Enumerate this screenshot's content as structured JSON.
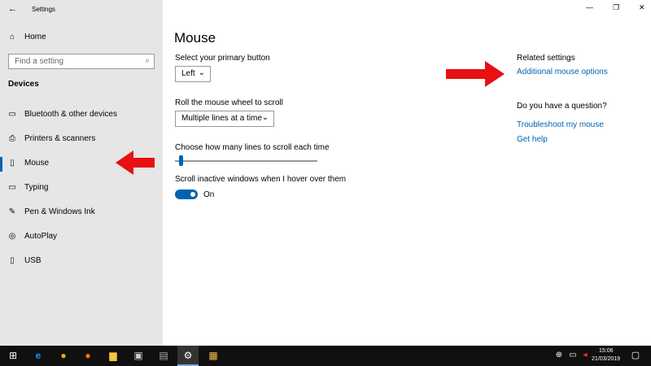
{
  "window": {
    "title": "Settings",
    "minimize": "—",
    "maximize": "❐",
    "close": "✕"
  },
  "sidebar": {
    "home": "Home",
    "search_placeholder": "Find a setting",
    "section": "Devices",
    "items": [
      {
        "label": "Bluetooth & other devices",
        "icon": "bluetooth-icon"
      },
      {
        "label": "Printers & scanners",
        "icon": "printer-icon"
      },
      {
        "label": "Mouse",
        "icon": "mouse-icon"
      },
      {
        "label": "Typing",
        "icon": "keyboard-icon"
      },
      {
        "label": "Pen & Windows Ink",
        "icon": "pen-icon"
      },
      {
        "label": "AutoPlay",
        "icon": "autoplay-icon"
      },
      {
        "label": "USB",
        "icon": "usb-icon"
      }
    ]
  },
  "main": {
    "title": "Mouse",
    "primary_label": "Select your primary button",
    "primary_value": "Left",
    "wheel_label": "Roll the mouse wheel to scroll",
    "wheel_value": "Multiple lines at a time",
    "lines_label": "Choose how many lines to scroll each time",
    "lines_value_fraction": 0.03,
    "inactive_label": "Scroll inactive windows when I hover over them",
    "inactive_state": "On"
  },
  "related": {
    "heading": "Related settings",
    "additional": "Additional mouse options",
    "question": "Do you have a question?",
    "troubleshoot": "Troubleshoot my mouse",
    "help": "Get help"
  },
  "taskbar": {
    "time": "15:06",
    "date": "21/03/2019"
  },
  "colors": {
    "accent": "#0063b1",
    "arrow": "#e81010"
  }
}
